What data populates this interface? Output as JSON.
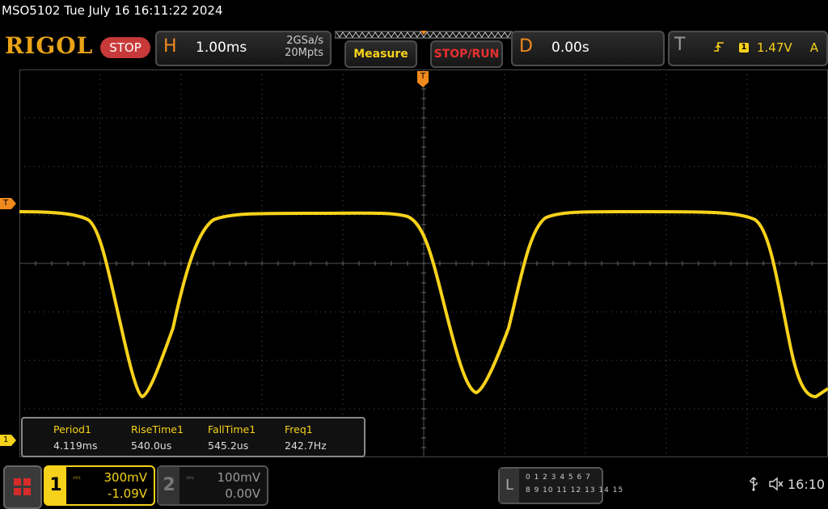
{
  "title_line": "MSO5102  Tue July 16 16:11:22 2024",
  "brand": "RIGOL",
  "run_state": "STOP",
  "horizontal": {
    "letter": "H",
    "scale": "1.00ms",
    "sample_rate": "2GSa/s",
    "mem_depth": "20Mpts"
  },
  "buttons": {
    "measure": "Measure",
    "stop_run": "STOP/RUN"
  },
  "delay": {
    "letter": "D",
    "value": "0.00s"
  },
  "trigger": {
    "letter": "T",
    "edge_icon": "rising-edge-icon",
    "source": "1",
    "level": "1.47V",
    "mode": "A"
  },
  "markers": {
    "trigger_level": "T",
    "channel1": "1",
    "trigger_position": "T"
  },
  "measurements": [
    {
      "label": "Period1",
      "value": "4.119ms"
    },
    {
      "label": "RiseTime1",
      "value": "540.0us"
    },
    {
      "label": "FallTime1",
      "value": "545.2us"
    },
    {
      "label": "Freq1",
      "value": "242.7Hz"
    }
  ],
  "channel1": {
    "num": "1",
    "scale": "300mV",
    "offset": "-1.09V",
    "color": "#f7d21b"
  },
  "channel2": {
    "num": "2",
    "scale": "100mV",
    "offset": "0.00V",
    "color": "#999999"
  },
  "logic": {
    "letter": "L",
    "row1": "0 1 2 3  4 5 6 7",
    "row2": "8 9 10 11 12 13 14 15"
  },
  "status": {
    "usb_icon": "usb-icon",
    "speaker_icon": "speaker-muted-icon",
    "time": "16:10"
  },
  "colors": {
    "accent": "#f08a1d",
    "trace": "#f7d21b",
    "stop": "#c83a3a"
  }
}
